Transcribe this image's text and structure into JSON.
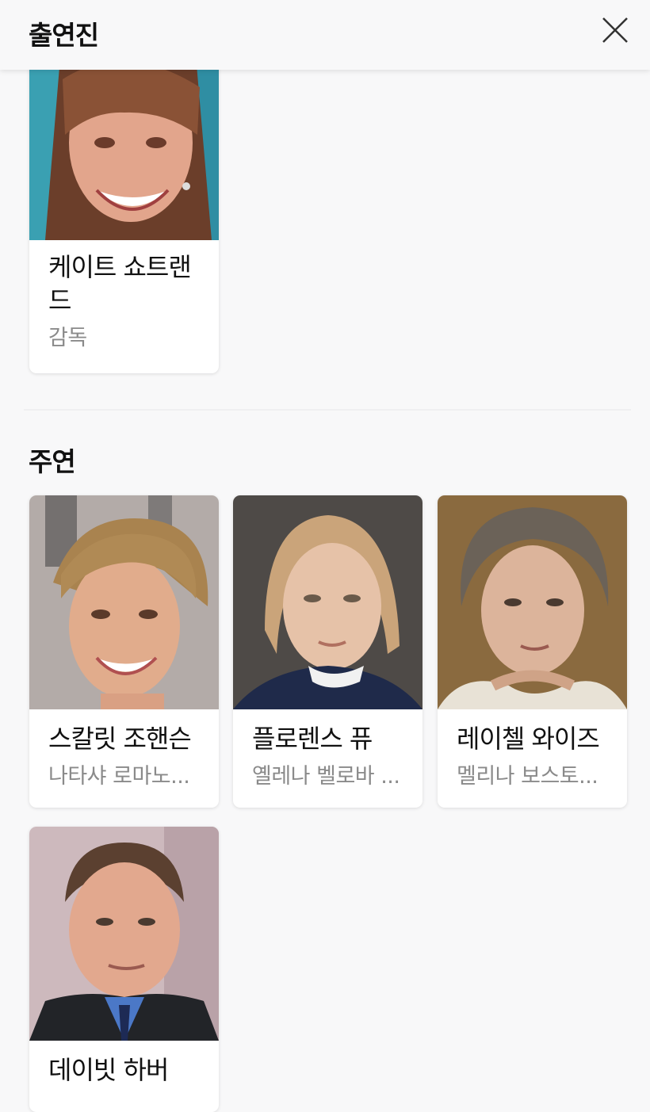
{
  "header": {
    "title": "출연진"
  },
  "director": {
    "name": "케이트 쇼트랜드",
    "name_lines": [
      "케이트 쇼트랜",
      "드"
    ],
    "role": "감독"
  },
  "main_cast": {
    "section_title": "주연",
    "items": [
      {
        "name": "스칼릿 조핸슨",
        "role": "나타샤 로마노..."
      },
      {
        "name": "플로렌스 퓨",
        "role": "옐레나 벨로바 ..."
      },
      {
        "name": "레이첼 와이즈",
        "role": "멜리나 보스토..."
      },
      {
        "name": "데이빗 하버",
        "role": ""
      }
    ]
  }
}
